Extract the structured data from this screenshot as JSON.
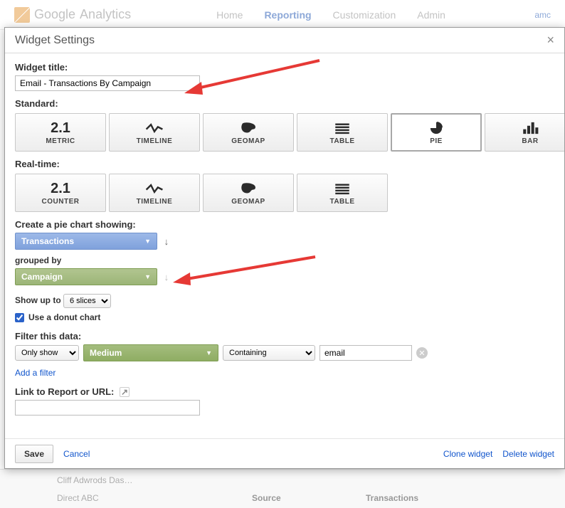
{
  "backdrop": {
    "brand1": "Google",
    "brand2": "Analytics",
    "nav": {
      "home": "Home",
      "reporting": "Reporting",
      "customization": "Customization",
      "admin": "Admin"
    },
    "user": "amc",
    "bottom": {
      "row1": "Cliff Adwrods Das…",
      "row2": "Direct   ABC",
      "col1": "Source",
      "col2": "Transactions"
    }
  },
  "modal": {
    "title": "Widget Settings",
    "close": "×"
  },
  "form": {
    "title_label": "Widget title:",
    "title_value": "Email - Transactions By Campaign",
    "standard_label": "Standard:",
    "realtime_label": "Real-time:",
    "pie_label": "Create a pie chart showing:",
    "metric_value": "Transactions",
    "grouped_label": "grouped by",
    "dimension_value": "Campaign",
    "showup_prefix": "Show up to",
    "slices_value": "6 slices",
    "donut_label": "Use a donut chart",
    "filter_label": "Filter this data:",
    "filter_mode": "Only show",
    "filter_dimension": "Medium",
    "filter_match": "Containing",
    "filter_value": "email",
    "add_filter": "Add a filter",
    "link_label": "Link to Report or URL:"
  },
  "tiles": {
    "standard": [
      {
        "label": "METRIC",
        "text": "2.1",
        "icon": ""
      },
      {
        "label": "TIMELINE",
        "text": "",
        "icon": "timeline"
      },
      {
        "label": "GEOMAP",
        "text": "",
        "icon": "geomap"
      },
      {
        "label": "TABLE",
        "text": "",
        "icon": "table"
      },
      {
        "label": "PIE",
        "text": "",
        "icon": "pie"
      },
      {
        "label": "BAR",
        "text": "",
        "icon": "bar"
      }
    ],
    "realtime": [
      {
        "label": "COUNTER",
        "text": "2.1",
        "icon": ""
      },
      {
        "label": "TIMELINE",
        "text": "",
        "icon": "timeline"
      },
      {
        "label": "GEOMAP",
        "text": "",
        "icon": "geomap"
      },
      {
        "label": "TABLE",
        "text": "",
        "icon": "table"
      }
    ],
    "selected_standard": 4
  },
  "footer": {
    "save": "Save",
    "cancel": "Cancel",
    "clone": "Clone widget",
    "delete": "Delete widget"
  }
}
